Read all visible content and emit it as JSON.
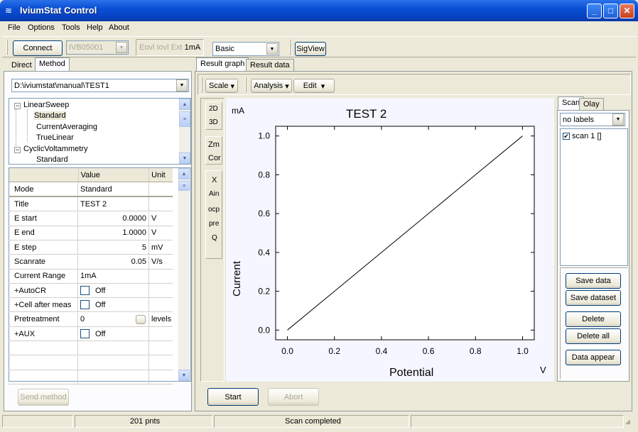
{
  "window": {
    "title": "IviumStat Control"
  },
  "menu": {
    "items": [
      "File",
      "Options",
      "Tools",
      "Help",
      "About"
    ]
  },
  "toolbar": {
    "connect_label": "Connect",
    "device_value": "IVB05001",
    "range_label_prefix": "Eovl Iovl Ext",
    "range_value": "1mA",
    "mode_value": "Basic",
    "sigview_label": "SigView"
  },
  "left_tabs": {
    "direct": "Direct",
    "method": "Method"
  },
  "method_path": "D:\\iviumstat\\manual\\TEST1",
  "tree": {
    "items": [
      {
        "label": "LinearSweep"
      },
      {
        "label": "Standard"
      },
      {
        "label": "CurrentAveraging"
      },
      {
        "label": "TrueLinear"
      },
      {
        "label": "CyclicVoltammetry"
      },
      {
        "label": "Standard"
      }
    ]
  },
  "grid": {
    "headers": [
      "",
      "Value",
      "Unit"
    ],
    "rows": [
      {
        "name": "Mode",
        "value": "Standard",
        "unit": ""
      },
      {
        "name": "Title",
        "value": "TEST 2",
        "unit": ""
      },
      {
        "name": "E start",
        "value": "0.0000",
        "unit": "V"
      },
      {
        "name": "E end",
        "value": "1.0000",
        "unit": "V"
      },
      {
        "name": "E step",
        "value": "5",
        "unit": "mV"
      },
      {
        "name": "Scanrate",
        "value": "0.05",
        "unit": "V/s"
      },
      {
        "name": "Current Range",
        "value": "1mA",
        "unit": ""
      },
      {
        "name": "+AutoCR",
        "value": "Off",
        "unit": ""
      },
      {
        "name": "+Cell after meas",
        "value": "Off",
        "unit": ""
      },
      {
        "name": "Pretreatment",
        "value": "0",
        "unit": "levels"
      },
      {
        "name": "+AUX",
        "value": "Off",
        "unit": ""
      }
    ]
  },
  "send_method_label": "Send method",
  "right_tabs": {
    "graph": "Result graph",
    "data": "Result data"
  },
  "graph_toolbar": {
    "scale": "Scale",
    "analysis": "Analysis",
    "edit": "Edit"
  },
  "side_tools": {
    "b2d": "2D",
    "b3d": "3D",
    "zm": "Zm",
    "cor": "Cor",
    "x": "X",
    "ain": "Ain",
    "ocp": "ocp",
    "pre": "pre",
    "q": "Q"
  },
  "scan_panel": {
    "tab_scan": "Scan",
    "tab_olay": "Olay",
    "labels_value": "no labels",
    "scan_item": "scan 1 []",
    "save_data": "Save data",
    "save_dataset": "Save dataset",
    "delete": "Delete",
    "delete_all": "Delete all",
    "data_appear": "Data appear"
  },
  "actions": {
    "start": "Start",
    "abort": "Abort"
  },
  "status": {
    "points": "201 pnts",
    "message": "Scan completed"
  },
  "colors": {
    "plot_bg": "#f5f6ff",
    "title_blue": "#0a4fd6"
  },
  "chart_data": {
    "type": "line",
    "title": "TEST 2",
    "xlabel": "Potential",
    "ylabel": "Current",
    "x_unit": "V",
    "y_unit": "mA",
    "xlim": [
      -0.05,
      1.05
    ],
    "ylim": [
      -0.05,
      1.05
    ],
    "xticks": [
      "0.0",
      "0.2",
      "0.4",
      "0.6",
      "0.8",
      "1.0"
    ],
    "yticks": [
      "0.0",
      "0.2",
      "0.4",
      "0.6",
      "0.8",
      "1.0"
    ],
    "series": [
      {
        "x": [
          0.0,
          0.2,
          0.4,
          0.6,
          0.8,
          1.0
        ],
        "y": [
          0.0,
          0.2,
          0.4,
          0.6,
          0.8,
          1.0
        ]
      }
    ]
  }
}
